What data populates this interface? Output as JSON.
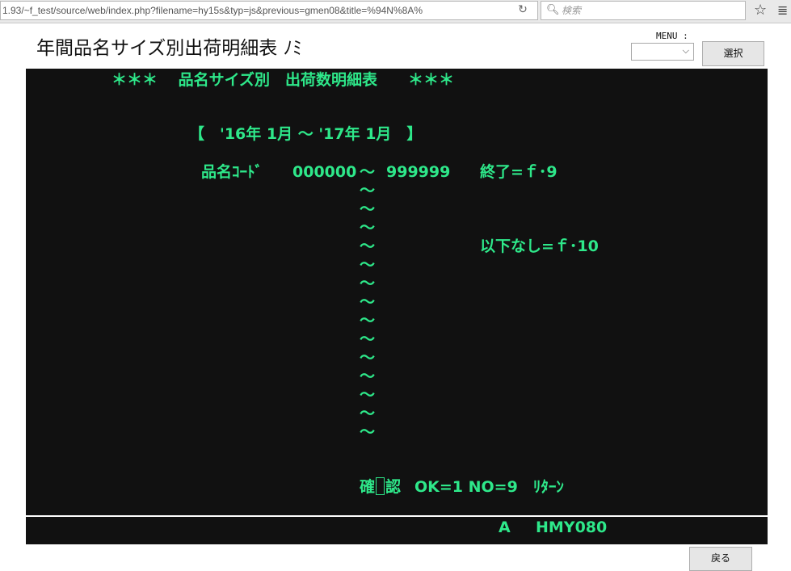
{
  "browser": {
    "url": "1.93/~f_test/source/web/index.php?filename=hy15s&typ=js&previous=gmen08&title=%94N%8A%",
    "search_placeholder": "検索"
  },
  "page": {
    "title": "年間品名サイズ別出荷明細表 ﾉﾐ",
    "menu_label": "MENU :",
    "menu_value": "",
    "select_button": "選択",
    "back_button": "戻る"
  },
  "terminal": {
    "heading": "＊＊＊　 品名サイズ別　出荷数明細表　　＊＊＊",
    "period": "【　'16年 1月 ～ '17年 1月　】",
    "code_label": "品名ｺｰﾄﾞ",
    "code_from": "000000",
    "code_to": "999999",
    "end_key": "終了=ｆ･9",
    "none_key": "以下なし=ｆ･10",
    "tilde": "～",
    "confirm_pre": "確",
    "confirm_post": "認",
    "confirm_options": "OK=1 NO=9　ﾘﾀｰﾝ",
    "status_mode": "A",
    "status_screen": "HMY080"
  }
}
